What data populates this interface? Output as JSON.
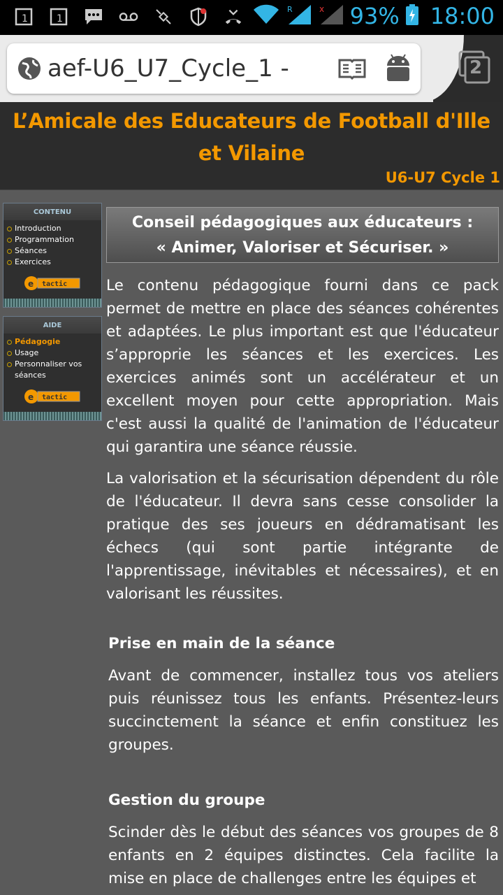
{
  "status": {
    "battery_pct": "93%",
    "time": "18:00"
  },
  "browser": {
    "url_title": "aef-U6_U7_Cycle_1 -",
    "tab_count": "2"
  },
  "site": {
    "title": "L’Amicale des Educateurs de Football d'Ille et Vilaine",
    "subtitle": "U6-U7 Cycle 1"
  },
  "sidebar": {
    "contenu": {
      "heading": "CONTENU",
      "items": [
        {
          "label": "Introduction"
        },
        {
          "label": "Programmation"
        },
        {
          "label": "Séances"
        },
        {
          "label": "Exercices"
        }
      ],
      "logo": "tactic"
    },
    "aide": {
      "heading": "AIDE",
      "items": [
        {
          "label": "Pédagogie"
        },
        {
          "label": "Usage"
        },
        {
          "label": "Personnaliser vos séances"
        }
      ],
      "logo": "tactic"
    }
  },
  "content": {
    "banner_line1": "Conseil pédagogiques aux éducateurs :",
    "banner_line2": "« Animer, Valoriser et Sécuriser. »",
    "para1": "Le contenu pédagogique fourni dans ce pack permet de mettre en place des séances cohérentes et adaptées. Le plus important est que l'éducateur s’approprie les séances et les exercices. Les exercices animés sont un accélérateur et un excellent moyen pour cette appropriation. Mais c'est aussi la qualité de l'animation de l'éducateur qui garantira une séance réussie.",
    "para2": "La valorisation et la sécurisation dépendent du rôle de l'éducateur. Il devra sans cesse consolider la pratique des ses joueurs en dédramatisant les échecs (qui sont partie intégrante de l'apprentissage, inévitables et nécessaires), et en valorisant les réussites.",
    "section1_title": "Prise en main de la séance",
    "section1_text": "Avant de commencer, installez tous vos ateliers puis réunissez tous les enfants. Présentez-leurs succinctement la séance et enfin constituez les groupes.",
    "section2_title": "Gestion du groupe",
    "section2_text": "Scinder dès le début des séances vos groupes de 8 enfants en 2 équipes distinctes. Cela facilite la mise en place de challenges entre les équipes et"
  }
}
